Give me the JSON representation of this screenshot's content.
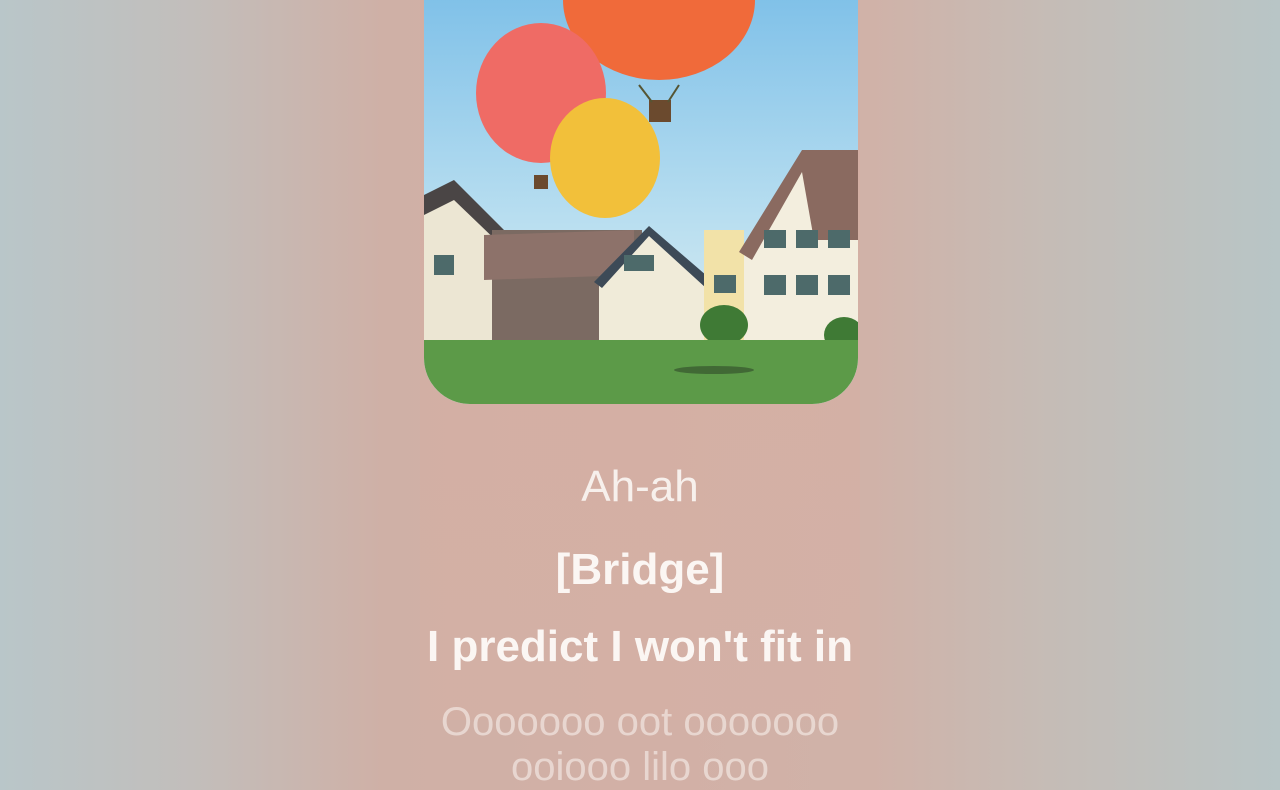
{
  "artwork": {
    "icon": "album-art-hot-air-balloons-village"
  },
  "lyrics": {
    "previous": "Ah-ah",
    "section": "[Bridge]",
    "current": "I predict I won't fit in",
    "next_partial": "Ooooooo oot ooooooo ooiooo lilo ooo"
  },
  "colors": {
    "text": "#fbf6f3",
    "panel_tint": "#d2b0a6"
  }
}
